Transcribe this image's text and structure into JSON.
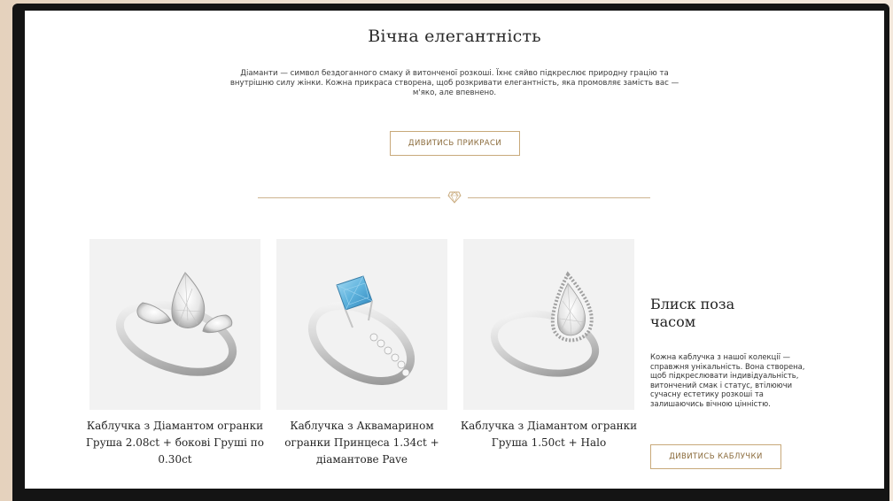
{
  "hero": {
    "title": "Вічна елегантність",
    "intro_line1": "Діаманти — символ бездоганного смаку й витонченої розкоші. Їхнє сяйво підкреслює природну грацію та",
    "intro_line2": "внутрішню силу жінки. Кожна прикраса створена, щоб розкривати елегантність, яка промовляє замість вас —",
    "intro_line3": "м'яко, але впевнено.",
    "button_label": "ДИВИТИСЬ ПРИКРАСИ"
  },
  "divider": {
    "icon": "diamond-icon",
    "color": "#cdb48f"
  },
  "products": [
    {
      "title_line1": "Каблучка з Діамантом огранки",
      "title_line2": "Груша 2.08ct + бокові Груші по",
      "title_line3": "0.30ct"
    },
    {
      "title_line1": "Каблучка з Аквамарином",
      "title_line2": "огранки Принцеса 1.34ct +",
      "title_line3": "діамантове Pave"
    },
    {
      "title_line1": "Каблучка з Діамантом огранки",
      "title_line2": "Груша 1.50ct + Halo",
      "title_line3": ""
    }
  ],
  "side": {
    "heading_line1": "Блиск поза",
    "heading_line2": "часом",
    "text_line1": "Кожна каблучка з нашої колекції —",
    "text_line2": "справжня унікальність. Вона створена,",
    "text_line3": "щоб підкреслювати індивідуальність,",
    "text_line4": "витончений смак і статус, втілюючи",
    "text_line5": "сучасну естетику розкоші та",
    "text_line6": "залишаючись вічною цінністю.",
    "button_label": "ДИВИТИСЬ КАБЛУЧКИ"
  },
  "colors": {
    "accent": "#c8a97a",
    "accent_text": "#8a6a3a",
    "card_bg": "#f2f2f2",
    "aquamarine": "#5fb3dd"
  }
}
